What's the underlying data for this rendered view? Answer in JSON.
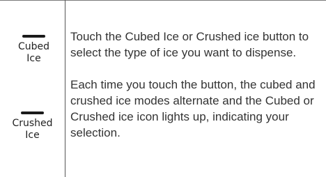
{
  "icons": {
    "cubed": {
      "line1": "Cubed",
      "line2": "Ice",
      "icon": "indicator-bar-icon"
    },
    "crushed": {
      "line1": "Crushed",
      "line2": "Ice",
      "icon": "indicator-bar-icon"
    }
  },
  "instructions": {
    "paragraph1": "Touch the Cubed Ice or Crushed ice button to select the type of ice you want to dispense.",
    "paragraph2": "Each time you touch the button, the cubed and crushed ice modes alternate and the Cubed or Crushed ice icon lights up, indicating your selection."
  },
  "colors": {
    "text": "#333333",
    "indicator": "#1a1a1a",
    "rule": "#555555"
  }
}
